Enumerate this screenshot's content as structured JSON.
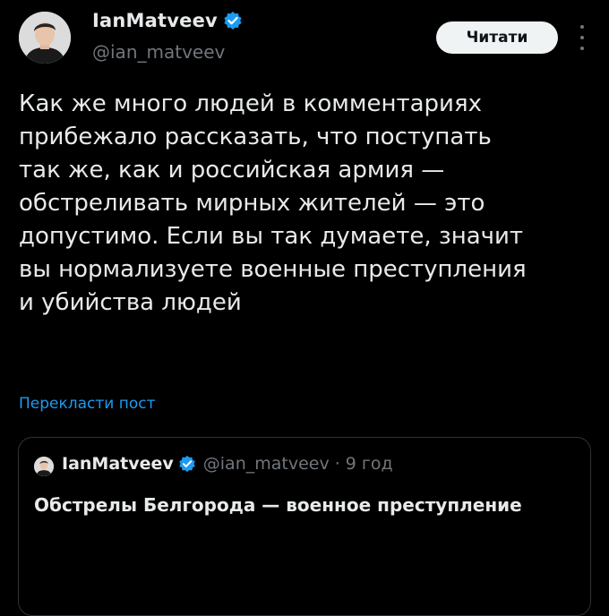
{
  "author": {
    "display_name": "IanMatveev",
    "handle": "@ian_matveev",
    "avatar_icon": "person-avatar-icon",
    "verified_icon": "verified-badge-icon"
  },
  "actions": {
    "follow_label": "Читати",
    "more_icon": "more-options-icon"
  },
  "tweet": {
    "text": "Как же много людей в комментариях\nприбежало рассказать, что поступать\nтак же, как и российская армия —\nобстреливать мирных жителей — это\nдопустимо. Если вы так думаете, значит\nвы нормализуете военные преступления\nи убийства людей",
    "translate_label": "Перекласти пост"
  },
  "quoted": {
    "display_name": "IanMatveev",
    "handle": "@ian_matveev",
    "separator": "·",
    "time": "9 год",
    "text": "Обстрелы Белгорода — военное преступление"
  },
  "colors": {
    "background": "#000000",
    "text": "#e7e9ea",
    "secondary": "#71767b",
    "link": "#1d9bf0",
    "verified": "#1d9bf0",
    "button_bg": "#eff3f4",
    "border": "#2f3336"
  }
}
